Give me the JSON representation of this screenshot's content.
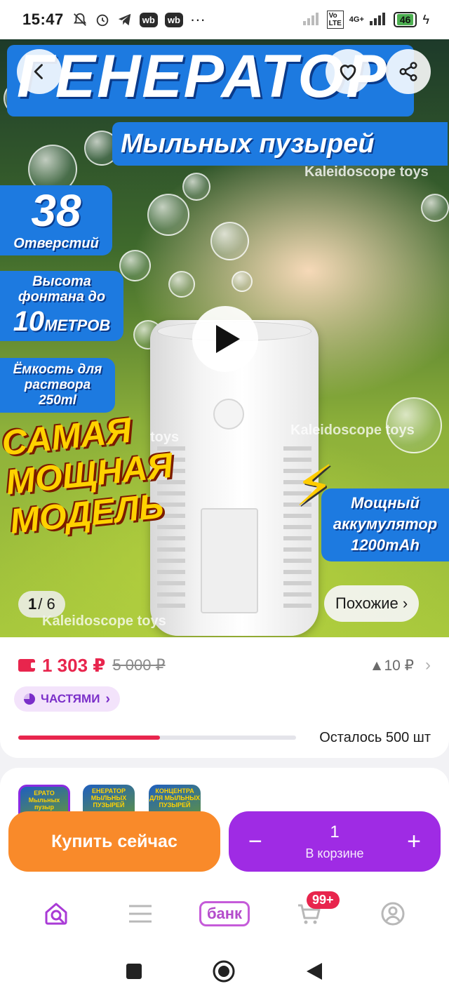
{
  "status_bar": {
    "time": "15:47",
    "wb1": "wb",
    "wb2": "wb",
    "more": "···",
    "network": "4G+",
    "battery": "46"
  },
  "hero": {
    "title": "ГЕНЕРАТОР",
    "subtitle": "Мыльных пузырей",
    "brand": "Kaleidoscope toys",
    "holes_number": "38",
    "holes_label": "Отверстий",
    "height_line1": "Высота",
    "height_line2": "фонтана до",
    "height_value": "10",
    "height_unit": "МЕТРОВ",
    "capacity_line1": "Ёмкость для",
    "capacity_line2": "раствора",
    "capacity_line3": "250ml",
    "powerful_line1": "САМАЯ",
    "powerful_line2": "МОЩНАЯ",
    "powerful_line3": "МОДЕЛЬ",
    "battery_line1": "Мощный",
    "battery_line2": "аккумулятор",
    "battery_line3": "1200mAh",
    "watermark1": "Kaleidoscope toys",
    "watermark2": "Kaleidoscope toys",
    "watermark3": "Kaleidoscope toys",
    "watermark_cut": "toys",
    "counter_current": "1",
    "counter_total": "/ 6",
    "similar_label": "Похожие ›"
  },
  "price": {
    "current": "1 303 ₽",
    "old": "5 000 ₽",
    "rise": "▲10 ₽",
    "chevron": "›",
    "installment": "ЧАСТЯМИ",
    "installment_chevron": "›",
    "stock_label": "Осталось 500 шт",
    "stock_level": 0.51
  },
  "thumbs": [
    {
      "text": "ЕРАТО Мыльных пузыр"
    },
    {
      "text": "ЕНЕРАТОР МЫЛЬНЫХ ПУЗЫРЕЙ"
    },
    {
      "text": "КОНЦЕНТРА ДЛЯ МЫЛЬНЫХ ПУЗЫРЕЙ"
    }
  ],
  "actions": {
    "buy_now": "Купить сейчас",
    "minus": "−",
    "plus": "+",
    "quantity": "1",
    "in_cart": "В корзине"
  },
  "bottom_nav": {
    "bank": "банк",
    "cart_badge": "99+"
  },
  "colors": {
    "accent_purple": "#9f2be4",
    "buy_orange": "#f98a2a",
    "price_red": "#e8254d"
  }
}
